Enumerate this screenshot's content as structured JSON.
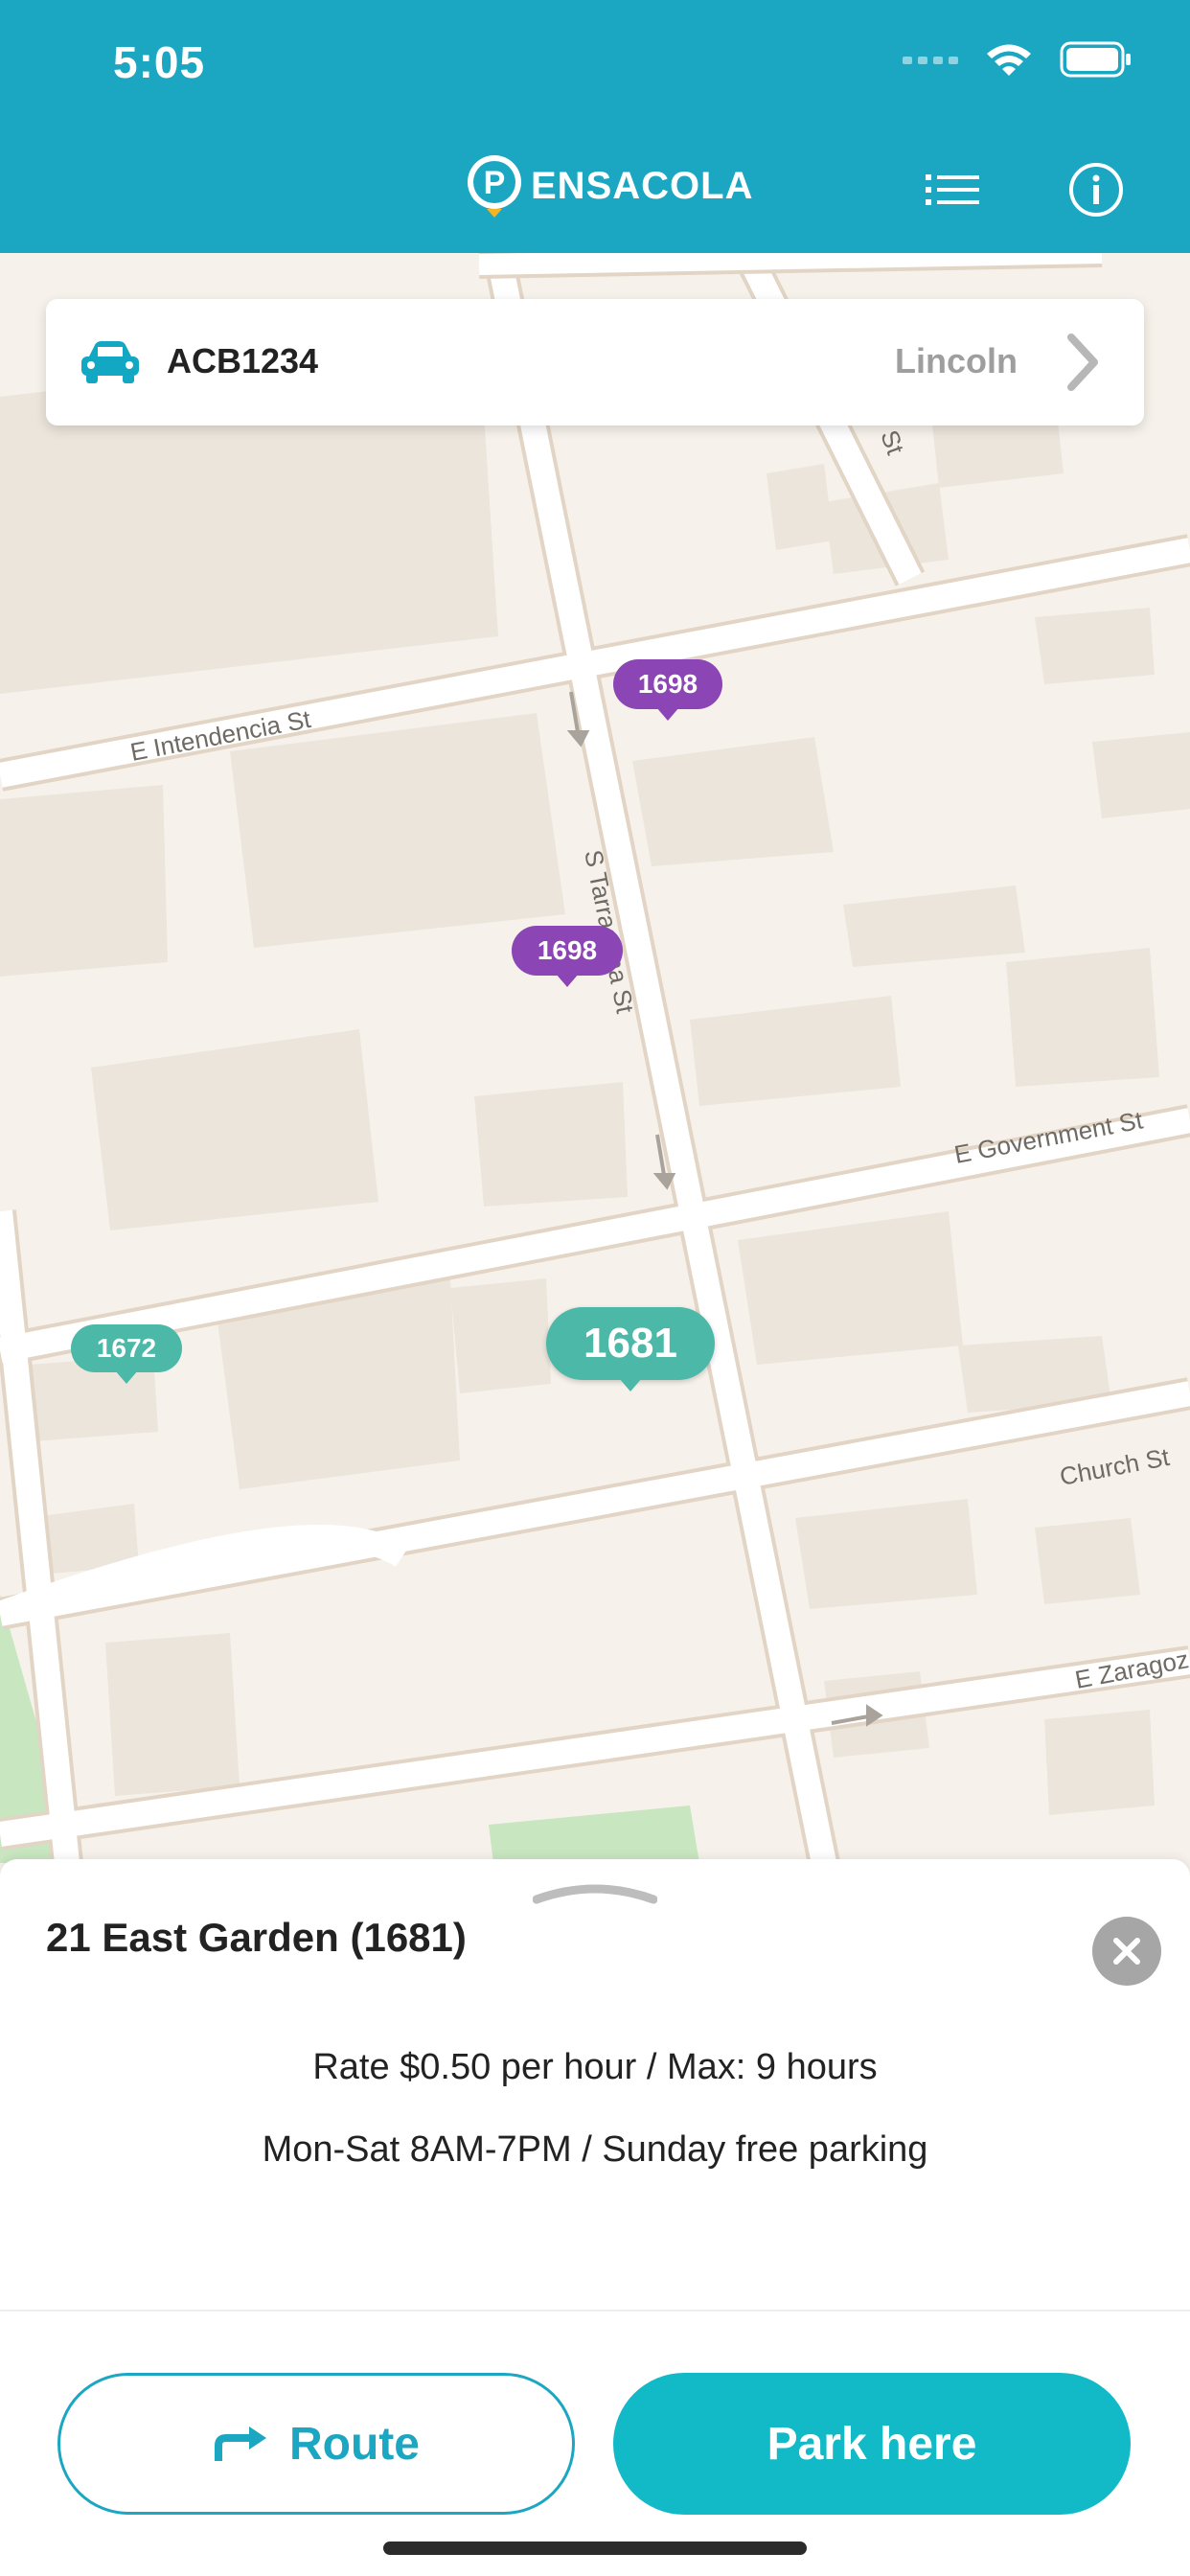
{
  "status_bar": {
    "time": "5:05",
    "icons": [
      "signal-icon",
      "wifi-icon",
      "battery-icon"
    ]
  },
  "header": {
    "logo_letter": "P",
    "logo_text": "ENSACOLA",
    "list_icon": "list-icon",
    "info_icon": "info-icon",
    "colors": {
      "background": "#1ba6c2"
    }
  },
  "vehicle": {
    "plate": "ACB1234",
    "zone": "Lincoln",
    "icon": "car-icon"
  },
  "map": {
    "streets": [
      "E Intendencia St",
      "S Tarragona St",
      "E Government St",
      "Church St",
      "E Zaragoz",
      "y St"
    ],
    "pins": [
      {
        "label": "1698",
        "color": "#8b45b5"
      },
      {
        "label": "1698",
        "color": "#8b45b5"
      },
      {
        "label": "1672",
        "color": "#4bb8a8"
      },
      {
        "label": "1681",
        "color": "#4bb8a8",
        "selected": true
      }
    ]
  },
  "details": {
    "title": "21 East Garden (1681)",
    "rate": "Rate $0.50 per hour / Max: 9 hours",
    "hours": "Mon-Sat 8AM-7PM / Sunday free parking"
  },
  "actions": {
    "route_label": "Route",
    "park_label": "Park here",
    "colors": {
      "primary": "#12b9c7"
    }
  }
}
